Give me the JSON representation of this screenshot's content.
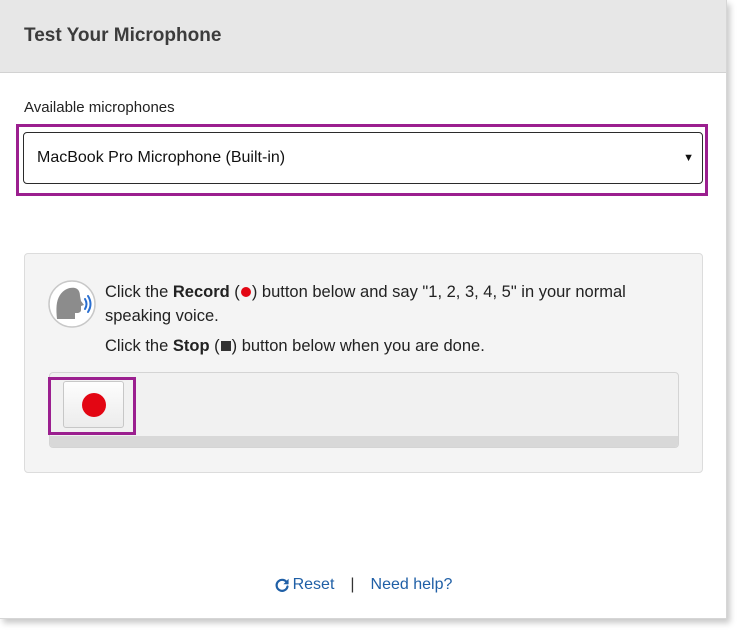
{
  "header": {
    "title": "Test Your Microphone"
  },
  "microphones": {
    "label": "Available microphones",
    "selected": "MacBook Pro Microphone (Built-in)"
  },
  "instructions": {
    "line1_prefix": "Click the ",
    "line1_record_word": "Record",
    "line1_open_paren": " (",
    "line1_close_paren": ") button below and say \"1, 2, 3, 4, 5\" in your normal speaking voice.",
    "line2_prefix": "Click the ",
    "line2_stop_word": "Stop",
    "line2_open_paren": " (",
    "line2_close_paren": ") button below when you are done."
  },
  "footer": {
    "reset_label": "Reset",
    "separator": "|",
    "help_label": "Need help?"
  },
  "colors": {
    "highlight": "#9b1f8f",
    "record_red": "#e30613",
    "link_blue": "#1f5fa6",
    "header_bg": "#e7e7e7"
  },
  "icons": {
    "speaker": "speaking-head-icon",
    "record": "record-dot-icon",
    "stop": "stop-square-icon",
    "reset": "refresh-icon",
    "dropdown": "dropdown-arrow-icon"
  }
}
